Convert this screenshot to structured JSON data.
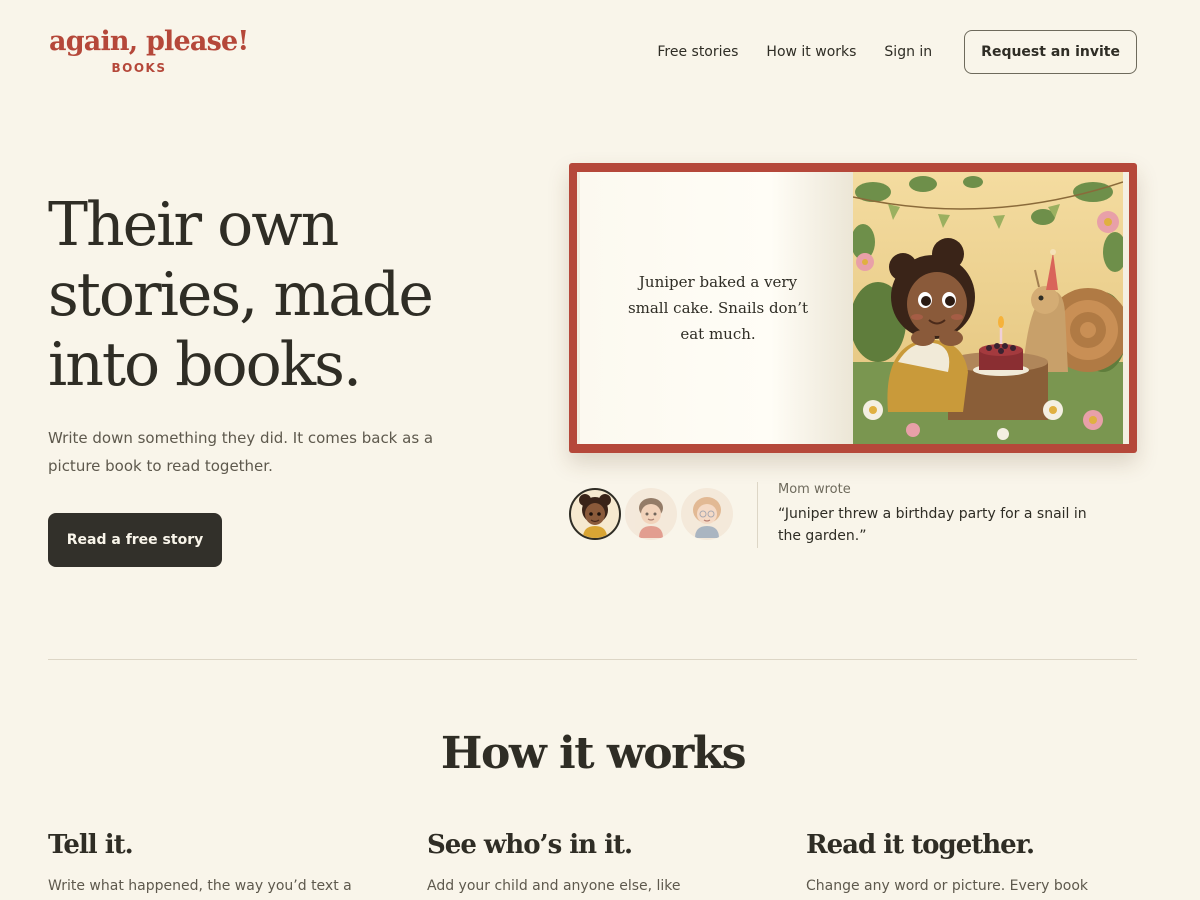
{
  "brand": {
    "name": "again, please!",
    "sub": "BOOKS",
    "color": "#b5483a"
  },
  "nav": {
    "links": [
      "Free stories",
      "How it works",
      "Sign in"
    ],
    "cta": "Request an invite"
  },
  "hero": {
    "title": "Their own stories, made into books.",
    "subtitle": "Write down something they did. It comes back as a picture book to read together.",
    "button": "Read a free story"
  },
  "book": {
    "page_text": "Juniper baked a very small cake. Snails don’t eat much.",
    "illustration": "girl-with-snail-birthday-cake"
  },
  "characters": {
    "avatars": [
      {
        "name": "girl-curly-hair-avatar",
        "selected": true
      },
      {
        "name": "boy-avatar",
        "selected": false
      },
      {
        "name": "girl-glasses-avatar",
        "selected": false
      }
    ],
    "label": "Mom wrote",
    "quote": "“Juniper threw a birthday party for a snail in the garden.”"
  },
  "how_it_works": {
    "title": "How it works",
    "steps": [
      {
        "title": "Tell it.",
        "desc": "Write what happened, the way you’d text a"
      },
      {
        "title": "See who’s in it.",
        "desc": "Add your child and anyone else, like"
      },
      {
        "title": "Read it together.",
        "desc": "Change any word or picture. Every book"
      }
    ]
  },
  "colors": {
    "background": "#f9f5ea",
    "dark": "#32302a",
    "accent": "#b5483a"
  }
}
